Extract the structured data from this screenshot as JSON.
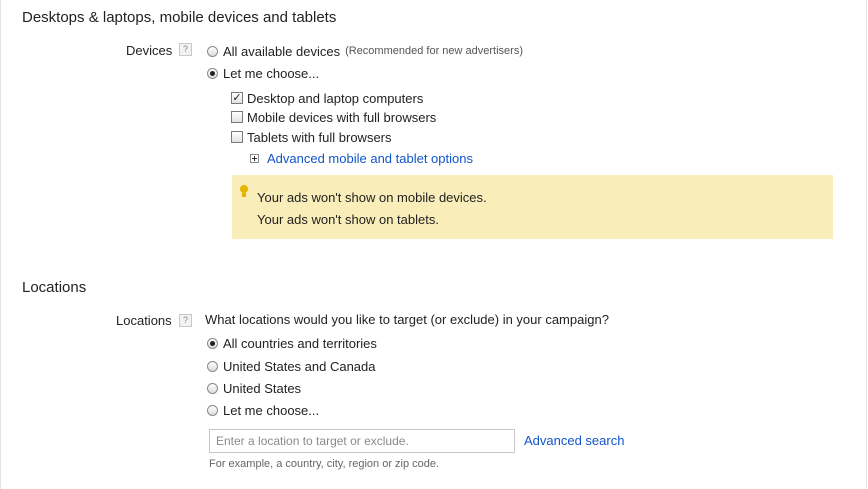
{
  "devices_section": {
    "title": "Desktops & laptops, mobile devices and tablets",
    "field_label": "Devices",
    "help_glyph": "?",
    "options": [
      {
        "label": "All available devices",
        "note": "(Recommended for new advertisers)",
        "selected": false
      },
      {
        "label": "Let me choose...",
        "note": "",
        "selected": true
      }
    ],
    "checkboxes": [
      {
        "label": "Desktop and laptop computers",
        "checked": true
      },
      {
        "label": "Mobile devices with full browsers",
        "checked": false
      },
      {
        "label": "Tablets with full browsers",
        "checked": false
      }
    ],
    "advanced_link": "Advanced mobile and tablet options",
    "warning": {
      "icon": "lightbulb-icon",
      "line1": "Your ads won't show on mobile devices.",
      "line2": "Your ads won't show on tablets."
    }
  },
  "locations_section": {
    "title": "Locations",
    "field_label": "Locations",
    "help_glyph": "?",
    "question": "What locations would you like to target (or exclude) in your campaign?",
    "options": [
      {
        "label": "All countries and territories",
        "selected": true
      },
      {
        "label": "United States and Canada",
        "selected": false
      },
      {
        "label": "United States",
        "selected": false
      },
      {
        "label": "Let me choose...",
        "selected": false
      }
    ],
    "search": {
      "placeholder": "Enter a location to target or exclude.",
      "value": "",
      "advanced_link": "Advanced search",
      "example": "For example, a country, city, region or zip code."
    }
  },
  "colors": {
    "link": "#1155cc",
    "warning_background": "#f9eeb9",
    "bulb": "#e8b400"
  }
}
